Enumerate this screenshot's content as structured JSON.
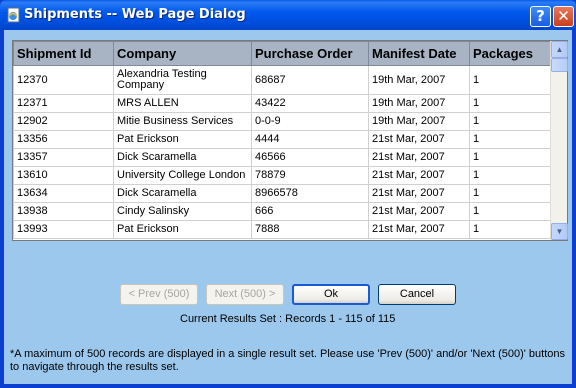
{
  "window": {
    "title": "Shipments -- Web Page Dialog",
    "help_label": "?",
    "close_label": "✕"
  },
  "grid": {
    "columns": [
      "Shipment Id",
      "Company",
      "Purchase Order",
      "Manifest Date",
      "Packages"
    ],
    "rows": [
      [
        "12370",
        "Alexandria Testing Company",
        "68687",
        "19th Mar, 2007",
        "1"
      ],
      [
        "12371",
        "MRS ALLEN",
        "43422",
        "19th Mar, 2007",
        "1"
      ],
      [
        "12902",
        "Mitie Business Services",
        "0-0-9",
        "19th Mar, 2007",
        "1"
      ],
      [
        "13356",
        "Pat Erickson",
        "4444",
        "21st Mar, 2007",
        "1"
      ],
      [
        "13357",
        "Dick Scaramella",
        "46566",
        "21st Mar, 2007",
        "1"
      ],
      [
        "13610",
        "University College London",
        "78879",
        "21st Mar, 2007",
        "1"
      ],
      [
        "13634",
        "Dick Scaramella",
        "8966578",
        "21st Mar, 2007",
        "1"
      ],
      [
        "13938",
        "Cindy Salinsky",
        "666",
        "21st Mar, 2007",
        "1"
      ],
      [
        "13993",
        "Pat Erickson",
        "7888",
        "21st Mar, 2007",
        "1"
      ]
    ]
  },
  "buttons": {
    "prev": "< Prev (500)",
    "next": "Next (500) >",
    "ok": "Ok",
    "cancel": "Cancel"
  },
  "results_text": "Current Results Set : Records 1 - 115  of  115",
  "note": "*A maximum of 500 records are displayed in a single result set. Please use 'Prev (500)' and/or 'Next (500)' buttons to navigate through the results set."
}
